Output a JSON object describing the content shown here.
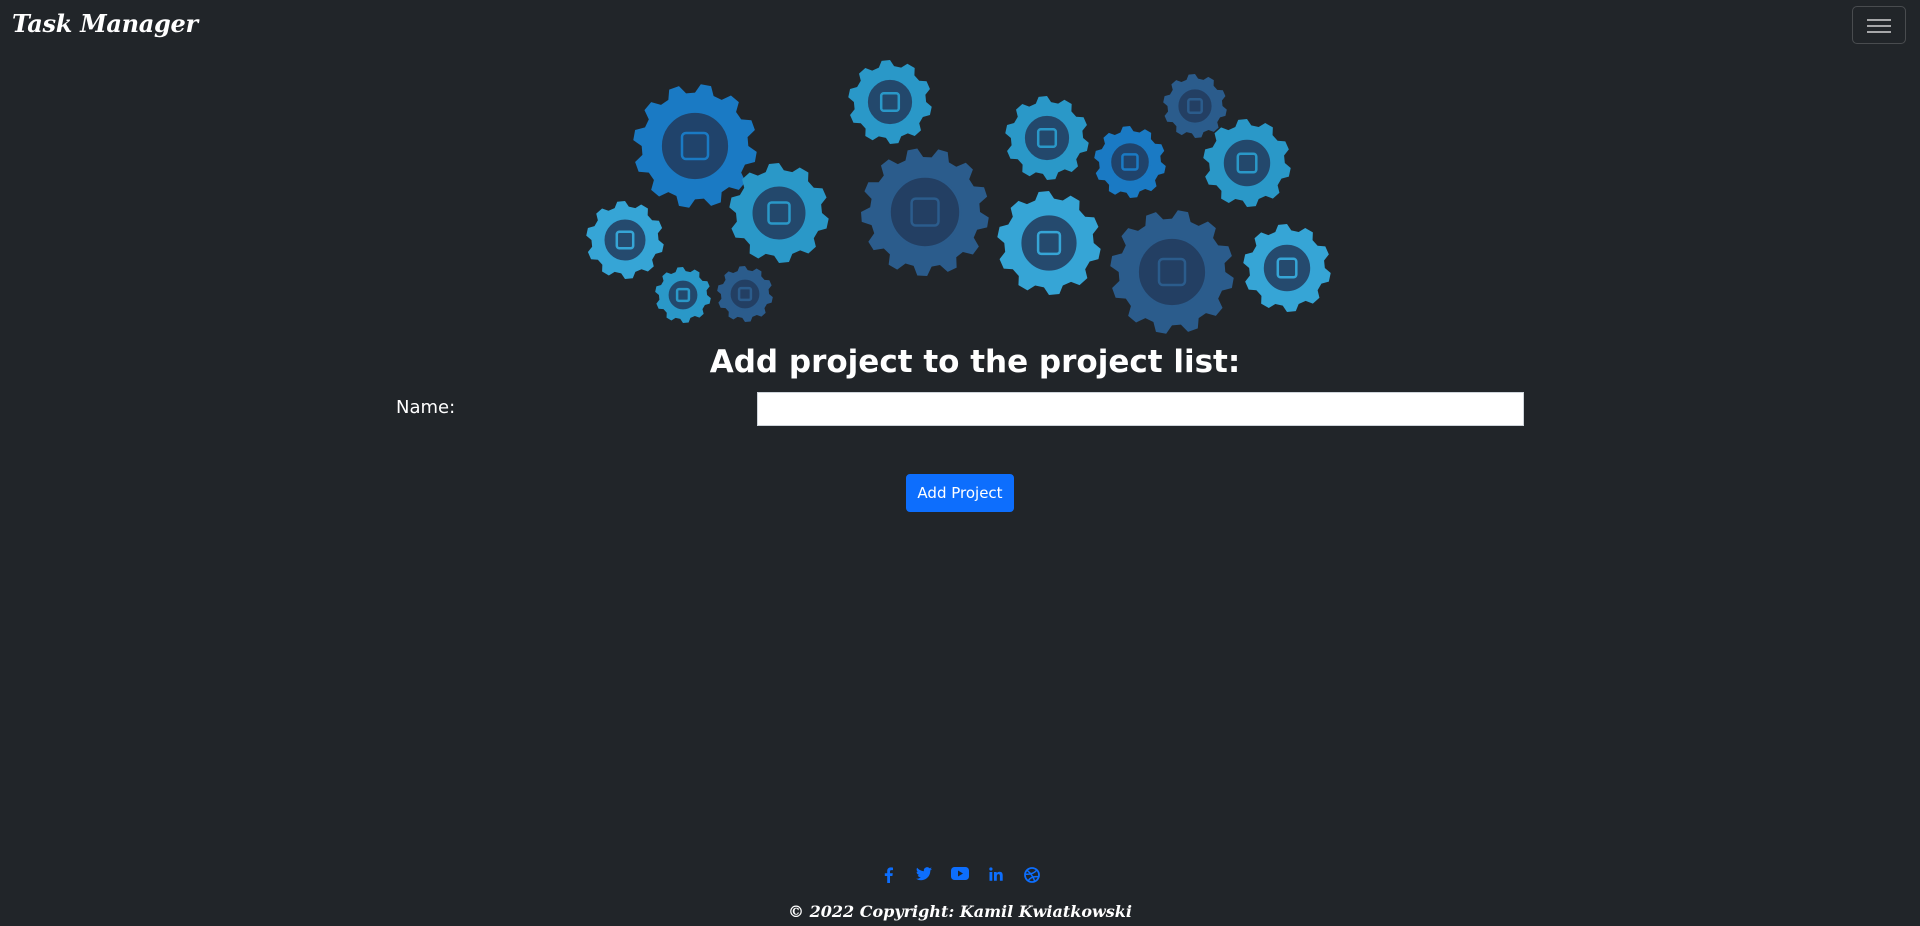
{
  "navbar": {
    "brand": "Task Manager",
    "toggler_icon": "hamburger-menu-icon"
  },
  "hero": {
    "image_icons": [
      "target-icon",
      "presentation-chart-icon",
      "calendar-icon",
      "bar-chart-icon",
      "briefcase-icon",
      "clipboard-checklist-icon",
      "pie-chart-icon",
      "store-icon",
      "lightbulb-icon",
      "credit-card-icon",
      "team-icon",
      "gold-bars-icon",
      "magnifier-icon",
      "puzzle-icon"
    ],
    "colors": [
      "#1a7ac4",
      "#2a98c8",
      "#2b5c8c",
      "#36a5d6"
    ]
  },
  "form": {
    "title": "Add project to the project list:",
    "name_label": "Name:",
    "name_value": "",
    "submit_label": "Add Project"
  },
  "footer": {
    "social": [
      {
        "name": "facebook-icon",
        "glyph": "f"
      },
      {
        "name": "twitter-icon",
        "glyph": ""
      },
      {
        "name": "youtube-icon",
        "glyph": ""
      },
      {
        "name": "linkedin-icon",
        "glyph": "in"
      },
      {
        "name": "dribbble-icon",
        "glyph": ""
      }
    ],
    "copyright": "© 2022 Copyright: Kamil Kwiatkowski"
  },
  "accent_color": "#0d6efd",
  "background_color": "#212529"
}
